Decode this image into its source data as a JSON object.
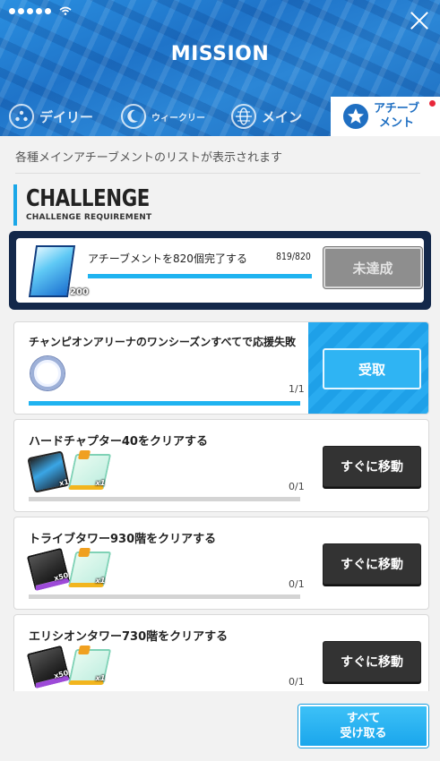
{
  "header": {
    "title": "MISSION",
    "tabs": [
      {
        "label": "デイリー",
        "icon": "daily-icon"
      },
      {
        "label": "ウィークリー",
        "icon": "weekly-icon"
      },
      {
        "label": "メイン",
        "icon": "globe-icon"
      },
      {
        "label": "アチーブメント",
        "label_lines": [
          "アチーブ",
          "メント"
        ],
        "icon": "star-icon",
        "active": true
      }
    ]
  },
  "description": "各種メインアチーブメントのリストが表示されます",
  "section": {
    "title": "CHALLENGE",
    "subtitle": "CHALLENGE REQUIREMENT"
  },
  "main_challenge": {
    "text": "アチーブメントを820個完了する",
    "progress_text": "819/820",
    "progress": 0.999,
    "reward_count": "200",
    "button": "未達成"
  },
  "missions": [
    {
      "title": "チャンピオンアリーナのワンシーズンすべてで応援失敗",
      "progress_text": "1/1",
      "progress": 1.0,
      "button": "受取",
      "state": "claimable",
      "rewards": [
        {
          "icon": "ring-icon",
          "count": ""
        }
      ]
    },
    {
      "title": "ハードチャプター40をクリアする",
      "progress_text": "0/1",
      "progress": 0.0,
      "button": "すぐに移動",
      "state": "go",
      "rewards": [
        {
          "icon": "device-icon",
          "count": "x1"
        },
        {
          "icon": "ticket-icon",
          "count": "x1"
        }
      ]
    },
    {
      "title": "トライブタワー930階をクリアする",
      "progress_text": "0/1",
      "progress": 0.0,
      "button": "すぐに移動",
      "state": "go",
      "rewards": [
        {
          "icon": "box-icon",
          "count": "x50"
        },
        {
          "icon": "ticket-icon",
          "count": "x1"
        }
      ]
    },
    {
      "title": "エリシオンタワー730階をクリアする",
      "progress_text": "0/1",
      "progress": 0.0,
      "button": "すぐに移動",
      "state": "go",
      "rewards": [
        {
          "icon": "box-icon",
          "count": "x50"
        },
        {
          "icon": "ticket-icon",
          "count": "x1"
        }
      ]
    }
  ],
  "footer": {
    "claim_all_lines": [
      "すべて",
      "受け取る"
    ]
  },
  "colors": {
    "accent": "#1fb3f0",
    "dark_button": "#333333",
    "header_blue": "#1f74c9"
  }
}
